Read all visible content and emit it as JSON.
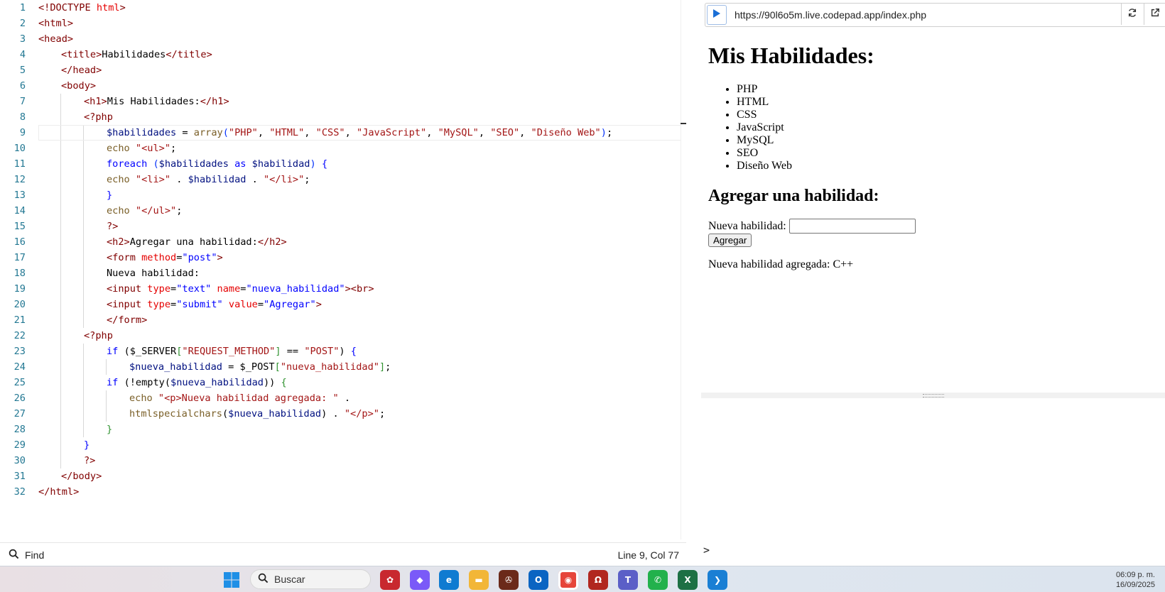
{
  "editor": {
    "lines": [
      {
        "n": "1",
        "indent": 0,
        "segs": [
          [
            "tag",
            "<!DOCTYPE "
          ],
          [
            "attr",
            "html"
          ],
          [
            "tag",
            ">"
          ]
        ]
      },
      {
        "n": "2",
        "indent": 0,
        "segs": [
          [
            "tag",
            "<html>"
          ]
        ]
      },
      {
        "n": "3",
        "indent": 0,
        "segs": [
          [
            "tag",
            "<head>"
          ]
        ]
      },
      {
        "n": "4",
        "indent": 1,
        "segs": [
          [
            "tag",
            "<title>"
          ],
          [
            "plain",
            "Habilidades"
          ],
          [
            "tag",
            "</title>"
          ]
        ]
      },
      {
        "n": "5",
        "indent": 1,
        "segs": [
          [
            "tag",
            "</head>"
          ]
        ]
      },
      {
        "n": "6",
        "indent": 1,
        "segs": [
          [
            "tag",
            "<body>"
          ]
        ]
      },
      {
        "n": "7",
        "indent": 2,
        "segs": [
          [
            "tag",
            "<h1>"
          ],
          [
            "plain",
            "Mis Habilidades:"
          ],
          [
            "tag",
            "</h1>"
          ]
        ]
      },
      {
        "n": "8",
        "indent": 2,
        "segs": [
          [
            "tag",
            "<?php"
          ]
        ]
      },
      {
        "n": "9",
        "indent": 3,
        "segs": [
          [
            "var",
            "$habilidades"
          ],
          [
            "plain",
            " = "
          ],
          [
            "fn",
            "array"
          ],
          [
            "brk",
            "("
          ],
          [
            "pstr",
            "\"PHP\""
          ],
          [
            "plain",
            ", "
          ],
          [
            "pstr",
            "\"HTML\""
          ],
          [
            "plain",
            ", "
          ],
          [
            "pstr",
            "\"CSS\""
          ],
          [
            "plain",
            ", "
          ],
          [
            "pstr",
            "\"JavaScript\""
          ],
          [
            "plain",
            ", "
          ],
          [
            "pstr",
            "\"MySQL\""
          ],
          [
            "plain",
            ", "
          ],
          [
            "pstr",
            "\"SEO\""
          ],
          [
            "plain",
            ", "
          ],
          [
            "pstr",
            "\"Diseño Web\""
          ],
          [
            "brk",
            ")"
          ],
          [
            "plain",
            ";"
          ]
        ]
      },
      {
        "n": "10",
        "indent": 3,
        "segs": [
          [
            "fn",
            "echo "
          ],
          [
            "pstr",
            "\"<ul>\""
          ],
          [
            "plain",
            ";"
          ]
        ]
      },
      {
        "n": "11",
        "indent": 3,
        "segs": [
          [
            "kw",
            "foreach "
          ],
          [
            "brk",
            "("
          ],
          [
            "var",
            "$habilidades"
          ],
          [
            "kw",
            " as "
          ],
          [
            "var",
            "$habilidad"
          ],
          [
            "brk",
            ")"
          ],
          [
            "kw",
            " {"
          ]
        ]
      },
      {
        "n": "12",
        "indent": 3,
        "segs": [
          [
            "fn",
            "echo "
          ],
          [
            "pstr",
            "\"<li>\""
          ],
          [
            "plain",
            " . "
          ],
          [
            "var",
            "$habilidad"
          ],
          [
            "plain",
            " . "
          ],
          [
            "pstr",
            "\"</li>\""
          ],
          [
            "plain",
            ";"
          ]
        ]
      },
      {
        "n": "13",
        "indent": 3,
        "segs": [
          [
            "kw",
            "}"
          ]
        ]
      },
      {
        "n": "14",
        "indent": 3,
        "segs": [
          [
            "fn",
            "echo "
          ],
          [
            "pstr",
            "\"</ul>\""
          ],
          [
            "plain",
            ";"
          ]
        ]
      },
      {
        "n": "15",
        "indent": 3,
        "segs": [
          [
            "tag",
            "?>"
          ]
        ]
      },
      {
        "n": "16",
        "indent": 3,
        "segs": [
          [
            "tag",
            "<h2>"
          ],
          [
            "plain",
            "Agregar una habilidad:"
          ],
          [
            "tag",
            "</h2>"
          ]
        ]
      },
      {
        "n": "17",
        "indent": 3,
        "segs": [
          [
            "tag",
            "<form "
          ],
          [
            "attr",
            "method"
          ],
          [
            "plain",
            "="
          ],
          [
            "str",
            "\"post\""
          ],
          [
            "tag",
            ">"
          ]
        ]
      },
      {
        "n": "18",
        "indent": 3,
        "segs": [
          [
            "plain",
            "Nueva habilidad:"
          ]
        ]
      },
      {
        "n": "19",
        "indent": 3,
        "segs": [
          [
            "tag",
            "<input "
          ],
          [
            "attr",
            "type"
          ],
          [
            "plain",
            "="
          ],
          [
            "str",
            "\"text\""
          ],
          [
            "plain",
            " "
          ],
          [
            "attr",
            "name"
          ],
          [
            "plain",
            "="
          ],
          [
            "str",
            "\"nueva_habilidad\""
          ],
          [
            "tag",
            ">"
          ],
          [
            "tag",
            "<br>"
          ]
        ]
      },
      {
        "n": "20",
        "indent": 3,
        "segs": [
          [
            "tag",
            "<input "
          ],
          [
            "attr",
            "type"
          ],
          [
            "plain",
            "="
          ],
          [
            "str",
            "\"submit\""
          ],
          [
            "plain",
            " "
          ],
          [
            "attr",
            "value"
          ],
          [
            "plain",
            "="
          ],
          [
            "str",
            "\"Agregar\""
          ],
          [
            "tag",
            ">"
          ]
        ]
      },
      {
        "n": "21",
        "indent": 3,
        "segs": [
          [
            "tag",
            "</form>"
          ]
        ]
      },
      {
        "n": "22",
        "indent": 2,
        "segs": [
          [
            "tag",
            "<?php"
          ]
        ]
      },
      {
        "n": "23",
        "indent": 3,
        "segs": [
          [
            "kw",
            "if "
          ],
          [
            "plain",
            "("
          ],
          [
            "plain",
            "$_SERVER"
          ],
          [
            "brk2",
            "["
          ],
          [
            "pstr",
            "\"REQUEST_METHOD\""
          ],
          [
            "brk2",
            "]"
          ],
          [
            "plain",
            " == "
          ],
          [
            "pstr",
            "\"POST\""
          ],
          [
            "plain",
            ")"
          ],
          [
            "kw",
            " {"
          ]
        ]
      },
      {
        "n": "24",
        "indent": 4,
        "segs": [
          [
            "var",
            "$nueva_habilidad"
          ],
          [
            "plain",
            " = "
          ],
          [
            "plain",
            "$_POST"
          ],
          [
            "brk2",
            "["
          ],
          [
            "pstr",
            "\"nueva_habilidad\""
          ],
          [
            "brk2",
            "]"
          ],
          [
            "plain",
            ";"
          ]
        ]
      },
      {
        "n": "25",
        "indent": 3,
        "segs": [
          [
            "kw",
            "if "
          ],
          [
            "plain",
            "(!empty("
          ],
          [
            "var",
            "$nueva_habilidad"
          ],
          [
            "plain",
            "))"
          ],
          [
            "brk2",
            " {"
          ]
        ]
      },
      {
        "n": "26",
        "indent": 4,
        "segs": [
          [
            "fn",
            "echo "
          ],
          [
            "pstr",
            "\"<p>Nueva habilidad agregada: \""
          ],
          [
            "plain",
            " ."
          ]
        ]
      },
      {
        "n": "27",
        "indent": 4,
        "segs": [
          [
            "fn",
            "htmlspecialchars"
          ],
          [
            "plain",
            "("
          ],
          [
            "var",
            "$nueva_habilidad"
          ],
          [
            "plain",
            ")"
          ],
          [
            "plain",
            " . "
          ],
          [
            "pstr",
            "\"</p>\""
          ],
          [
            "plain",
            ";"
          ]
        ]
      },
      {
        "n": "28",
        "indent": 3,
        "segs": [
          [
            "brk2",
            "}"
          ]
        ]
      },
      {
        "n": "29",
        "indent": 2,
        "segs": [
          [
            "kw",
            "}"
          ]
        ]
      },
      {
        "n": "30",
        "indent": 2,
        "segs": [
          [
            "tag",
            "?>"
          ]
        ]
      },
      {
        "n": "31",
        "indent": 1,
        "segs": [
          [
            "tag",
            "</body>"
          ]
        ]
      },
      {
        "n": "32",
        "indent": 0,
        "segs": [
          [
            "tag",
            "</html>"
          ]
        ]
      }
    ],
    "active_line": 9
  },
  "status": {
    "find_label": "Find",
    "cursor_position": "Line 9, Col 77"
  },
  "preview": {
    "url": "https://90l6o5m.live.codepad.app/index.php",
    "heading": "Mis Habilidades:",
    "skills": [
      "PHP",
      "HTML",
      "CSS",
      "JavaScript",
      "MySQL",
      "SEO",
      "Diseño Web"
    ],
    "subheading": "Agregar una habilidad:",
    "field_label": "Nueva habilidad:",
    "field_value": "",
    "submit_label": "Agregar",
    "result_text": "Nueva habilidad agregada: C++",
    "console_prompt": ">"
  },
  "taskbar": {
    "search_placeholder": "Buscar",
    "time": "06:09 p. m.",
    "date": "16/09/2025",
    "apps": [
      {
        "name": "start-menu-icon"
      },
      {
        "name": "widgets-icon",
        "color": "#c8282f"
      },
      {
        "name": "copilot-icon",
        "color": "#7a5af8"
      },
      {
        "name": "edge-browser-icon",
        "color": "#0f7bd1"
      },
      {
        "name": "file-explorer-icon",
        "color": "#f2b637"
      },
      {
        "name": "app-wheel-icon",
        "color": "#6b2a1a"
      },
      {
        "name": "outlook-icon",
        "color": "#0a64c2"
      },
      {
        "name": "chrome-browser-icon",
        "color": "#e6453a"
      },
      {
        "name": "app-ring-icon",
        "color": "#b1271f"
      },
      {
        "name": "teams-icon",
        "color": "#5b5fc7"
      },
      {
        "name": "whatsapp-icon",
        "color": "#22b14c"
      },
      {
        "name": "excel-icon",
        "color": "#1d7044"
      },
      {
        "name": "vscode-icon",
        "color": "#1a7fd4"
      }
    ]
  }
}
